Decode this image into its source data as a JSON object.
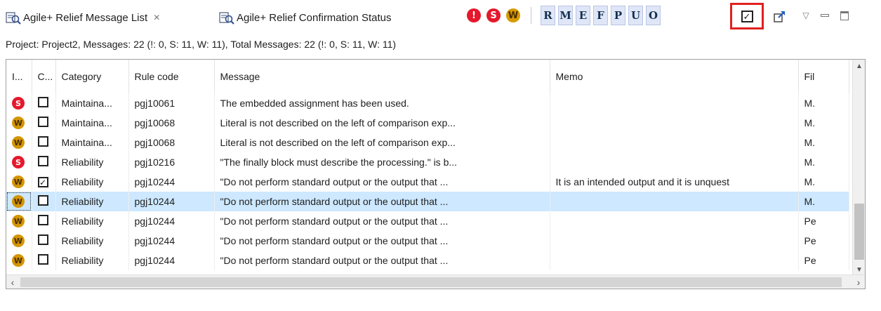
{
  "tabs": {
    "active_label": "Agile+ Relief Message List",
    "close_glyph": "✕",
    "inactive_label": "Agile+ Relief Confirmation Status"
  },
  "toolbar": {
    "severity_buttons": [
      {
        "glyph": "!",
        "icon": "important-severity-icon",
        "color": "#e5182c"
      },
      {
        "glyph": "S",
        "icon": "serious-severity-icon",
        "color": "#e5182c"
      },
      {
        "glyph": "W",
        "icon": "warning-severity-icon",
        "color": "#d79b00"
      }
    ],
    "category_buttons": [
      "R",
      "M",
      "E",
      "F",
      "P",
      "U",
      "O"
    ],
    "confirm_glyph": "✓",
    "menu_glyph": "▽"
  },
  "summary": "Project: Project2,  Messages: 22 (!: 0, S: 11, W: 11),  Total Messages: 22 (!: 0, S: 11, W: 11)",
  "table": {
    "columns": [
      "I...",
      "C...",
      "Category",
      "Rule code",
      "Message",
      "Memo",
      "Fil"
    ],
    "rows": [
      {
        "sev": "S",
        "checked": false,
        "category": "Maintaina...",
        "rule": "pgj10061",
        "message": "The embedded assignment has been used.",
        "memo": "",
        "file": "M."
      },
      {
        "sev": "W",
        "checked": false,
        "category": "Maintaina...",
        "rule": "pgj10068",
        "message": "Literal is not described on the left of comparison exp...",
        "memo": "",
        "file": "M."
      },
      {
        "sev": "W",
        "checked": false,
        "category": "Maintaina...",
        "rule": "pgj10068",
        "message": "Literal is not described on the left of comparison exp...",
        "memo": "",
        "file": "M."
      },
      {
        "sev": "S",
        "checked": false,
        "category": "Reliability",
        "rule": "pgj10216",
        "message": "\"The finally block must describe the processing.\" is b...",
        "memo": "",
        "file": "M."
      },
      {
        "sev": "W",
        "checked": true,
        "category": "Reliability",
        "rule": "pgj10244",
        "message": "\"Do not perform standard output or the output that ...",
        "memo": "It is an intended output and it is unquest",
        "file": "M."
      },
      {
        "sev": "W",
        "checked": false,
        "category": "Reliability",
        "rule": "pgj10244",
        "message": "\"Do not perform standard output or the output that ...",
        "memo": "",
        "file": "M.",
        "selected": true
      },
      {
        "sev": "W",
        "checked": false,
        "category": "Reliability",
        "rule": "pgj10244",
        "message": "\"Do not perform standard output or the output that ...",
        "memo": "",
        "file": "Pe"
      },
      {
        "sev": "W",
        "checked": false,
        "category": "Reliability",
        "rule": "pgj10244",
        "message": "\"Do not perform standard output or the output that ...",
        "memo": "",
        "file": "Pe"
      },
      {
        "sev": "W",
        "checked": false,
        "category": "Reliability",
        "rule": "pgj10244",
        "message": "\"Do not perform standard output or the output that ...",
        "memo": "",
        "file": "Pe"
      }
    ]
  },
  "colors": {
    "selection": "#cde8ff",
    "highlight_border": "#e02020",
    "serious": "#e5182c",
    "warning": "#d49500"
  }
}
